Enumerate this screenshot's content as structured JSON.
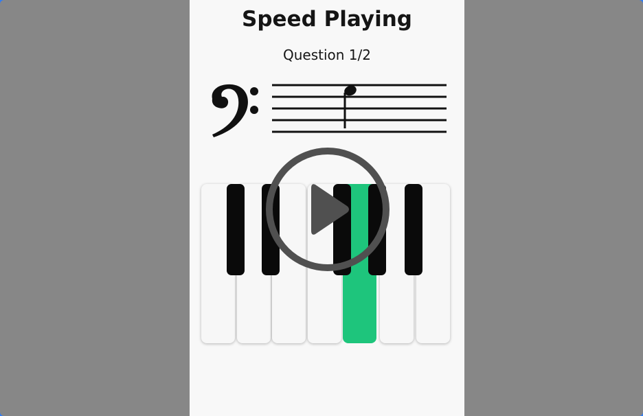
{
  "header": {
    "title": "Speed Playing",
    "question": "Question 1/2"
  },
  "staff": {
    "clef": "bass-clef-icon",
    "note": "quarter-note-icon"
  },
  "keyboard": {
    "white_keys": 7,
    "black_keys": 5,
    "highlighted_white_key": 5,
    "highlight_color": "#1ec57c"
  },
  "overlay": {
    "icon": "play-icon",
    "color": "#505050"
  },
  "colors": {
    "backdrop": "#878787",
    "panel": "#f8f8f8"
  }
}
